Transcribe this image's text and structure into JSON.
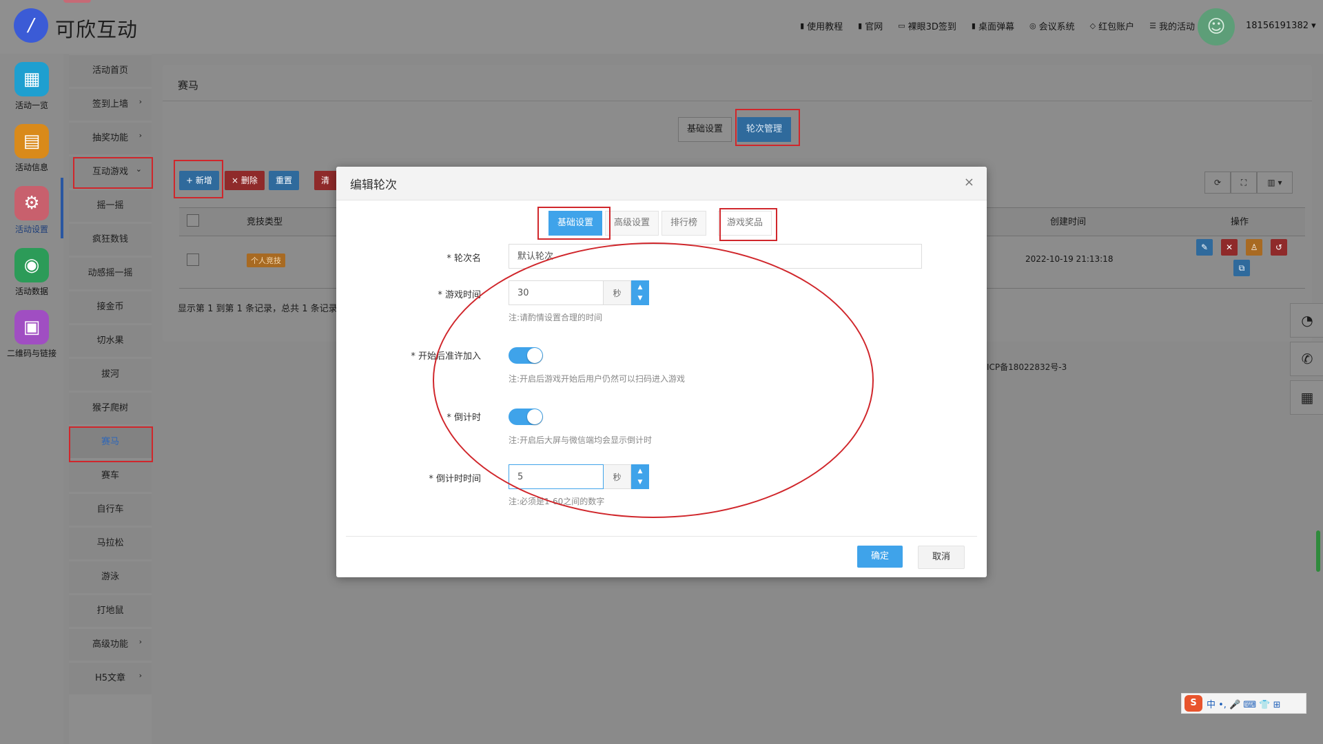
{
  "app": {
    "logo_text": "可欣互动",
    "logo_glyph": "/"
  },
  "topnav": [
    {
      "icon": "document-icon",
      "label": "使用教程"
    },
    {
      "icon": "document-icon",
      "label": "官网"
    },
    {
      "icon": "monitor-icon",
      "label": "裸眼3D签到"
    },
    {
      "icon": "document-icon",
      "label": "桌面弹幕"
    },
    {
      "icon": "meeting-icon",
      "label": "会议系统"
    },
    {
      "icon": "shield-icon",
      "label": "红包账户"
    },
    {
      "icon": "list-icon",
      "label": "我的活动"
    }
  ],
  "user": {
    "phone": "18156191382 ▾"
  },
  "rail": [
    {
      "label": "活动一览",
      "color": "#1e9fd0",
      "icon": "grid-icon",
      "glyph": "▦"
    },
    {
      "label": "活动信息",
      "color": "#d98a1a",
      "icon": "file-icon",
      "glyph": "▤"
    },
    {
      "label": "活动设置",
      "color": "#c8606d",
      "icon": "gear-icon",
      "glyph": "⚙"
    },
    {
      "label": "活动数据",
      "color": "#2c9b58",
      "icon": "database-icon",
      "glyph": "◉"
    },
    {
      "label": "二维码与链接",
      "color": "#a04ec2",
      "icon": "qrcode-icon",
      "glyph": "▣"
    }
  ],
  "submenu": [
    {
      "label": "活动首页",
      "chev": ""
    },
    {
      "label": "签到上墙",
      "chev": "›"
    },
    {
      "label": "抽奖功能",
      "chev": "›"
    },
    {
      "label": "互动游戏",
      "chev": "⌄"
    },
    {
      "label": "摇一摇",
      "chev": ""
    },
    {
      "label": "疯狂数钱",
      "chev": ""
    },
    {
      "label": "动感摇一摇",
      "chev": ""
    },
    {
      "label": "接金币",
      "chev": ""
    },
    {
      "label": "切水果",
      "chev": ""
    },
    {
      "label": "拔河",
      "chev": ""
    },
    {
      "label": "猴子爬树",
      "chev": ""
    },
    {
      "label": "赛马",
      "chev": ""
    },
    {
      "label": "赛车",
      "chev": ""
    },
    {
      "label": "自行车",
      "chev": ""
    },
    {
      "label": "马拉松",
      "chev": ""
    },
    {
      "label": "游泳",
      "chev": ""
    },
    {
      "label": "打地鼠",
      "chev": ""
    },
    {
      "label": "高级功能",
      "chev": "›"
    },
    {
      "label": "H5文章",
      "chev": "›"
    }
  ],
  "panel": {
    "title": "赛马",
    "tabs": [
      "基础设置",
      "轮次管理"
    ],
    "toolbar": {
      "add": "+ 新增",
      "delete": "× 删除",
      "reset": "重置",
      "clear": "清"
    },
    "table": {
      "headers": {
        "type": "竞技类型",
        "created": "创建时间",
        "ops": "操作"
      },
      "row": {
        "type_badge": "个人竞技",
        "created": "2022-10-19 21:13:18"
      }
    },
    "pager": "显示第 1 到第 1 条记录，总共 1 条记录",
    "icp": "ICP备18022832号-3"
  },
  "modal": {
    "title": "编辑轮次",
    "close": "×",
    "tabs": [
      "基础设置",
      "高级设置",
      "排行榜",
      "游戏奖品"
    ],
    "fields": {
      "round_name": {
        "label": "* 轮次名",
        "value": "默认轮次"
      },
      "game_time": {
        "label": "* 游戏时间",
        "value": "30",
        "unit": "秒",
        "note": "注:请酌情设置合理的时间"
      },
      "allow_join": {
        "label": "* 开始后准许加入",
        "on": true,
        "note": "注:开启后游戏开始后用户仍然可以扫码进入游戏"
      },
      "countdown": {
        "label": "* 倒计时",
        "on": true,
        "note": "注:开启后大屏与微信端均会显示倒计时"
      },
      "countdown_time": {
        "label": "* 倒计时时间",
        "value": "5",
        "unit": "秒",
        "note": "注:必须是1-60之间的数字"
      }
    },
    "confirm": "确定",
    "cancel": "取消"
  },
  "ime": {
    "logo": "S",
    "text": "中 •, 🎤 ⌨ 👕 ⊞"
  },
  "colors": {
    "accent": "#3fa3ea",
    "highlight": "#d0262b"
  }
}
